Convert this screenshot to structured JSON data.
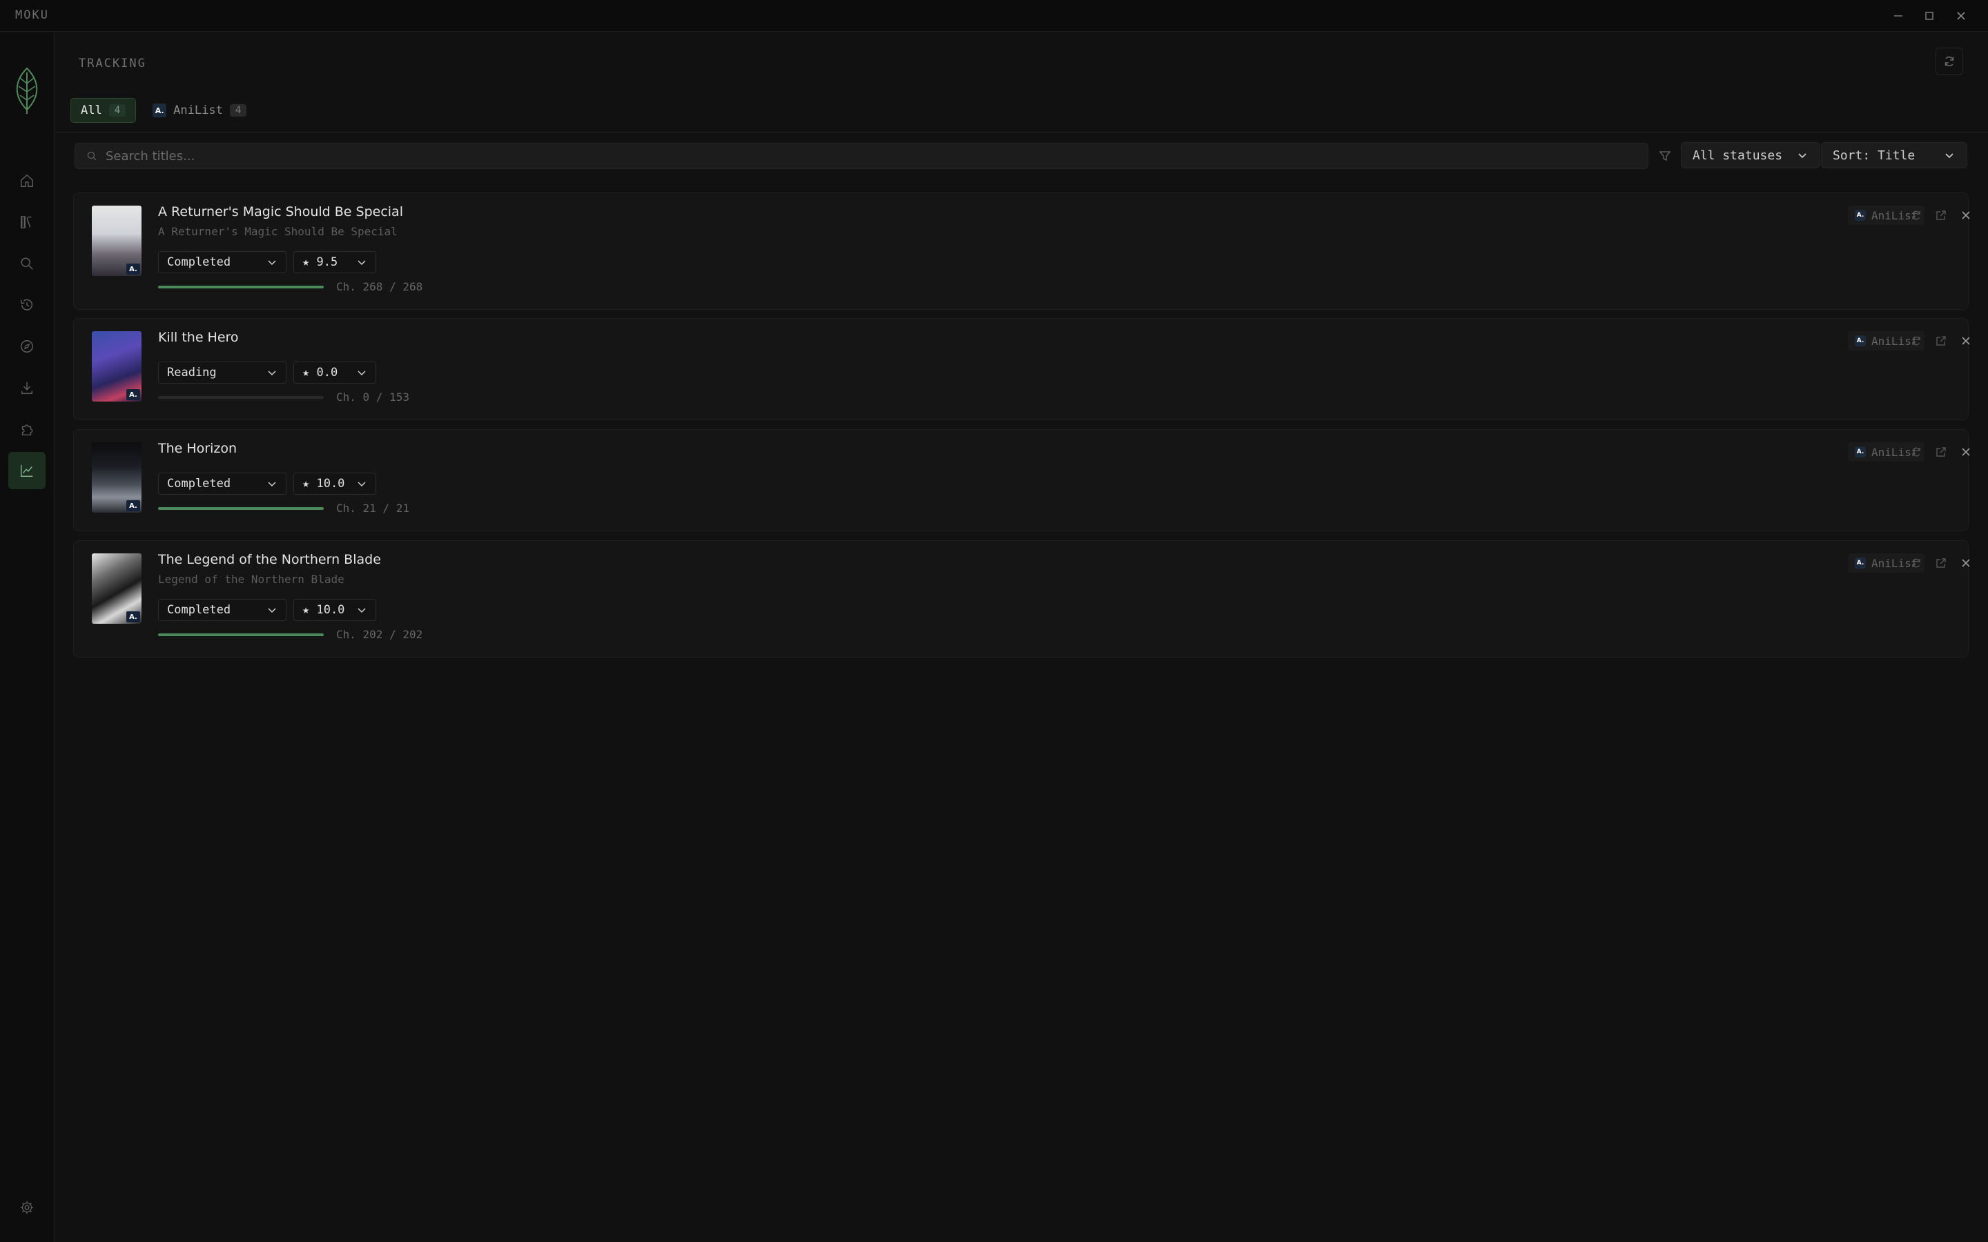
{
  "app": {
    "name": "MOKU"
  },
  "page": {
    "title": "TRACKING"
  },
  "tabs": [
    {
      "label": "All",
      "count": "4"
    },
    {
      "label": "AniList",
      "count": "4",
      "badge": "A."
    }
  ],
  "search": {
    "placeholder": "Search titles..."
  },
  "filters": {
    "status": "All statuses",
    "sort": "Sort: Title"
  },
  "entries": [
    {
      "title": "A Returner's Magic Should Be Special",
      "subtitle": "A Returner's Magic Should Be Special",
      "status": "Completed",
      "score": "★ 9.5",
      "chapters": "Ch. 268 / 268",
      "progress": 1.0,
      "tracker": "AniList"
    },
    {
      "title": "Kill the Hero",
      "subtitle": "",
      "status": "Reading",
      "score": "★ 0.0",
      "chapters": "Ch. 0 / 153",
      "progress": 0.0,
      "tracker": "AniList"
    },
    {
      "title": "The Horizon",
      "subtitle": "",
      "status": "Completed",
      "score": "★ 10.0",
      "chapters": "Ch. 21 / 21",
      "progress": 1.0,
      "tracker": "AniList"
    },
    {
      "title": "The Legend of the Northern Blade",
      "subtitle": "Legend of the Northern Blade",
      "status": "Completed",
      "score": "★ 10.0",
      "chapters": "Ch. 202 / 202",
      "progress": 1.0,
      "tracker": "AniList"
    }
  ],
  "badge_text": "A.",
  "colors": {
    "accent": "#4c8a5c",
    "active_nav": "#1c2e20",
    "background": "#111111"
  },
  "icons": {
    "window": [
      "minimize-icon",
      "maximize-icon",
      "close-icon"
    ],
    "nav": [
      "home-icon",
      "library-icon",
      "search-icon",
      "history-icon",
      "explore-icon",
      "download-icon",
      "extensions-icon",
      "tracking-icon",
      "settings-icon"
    ]
  }
}
